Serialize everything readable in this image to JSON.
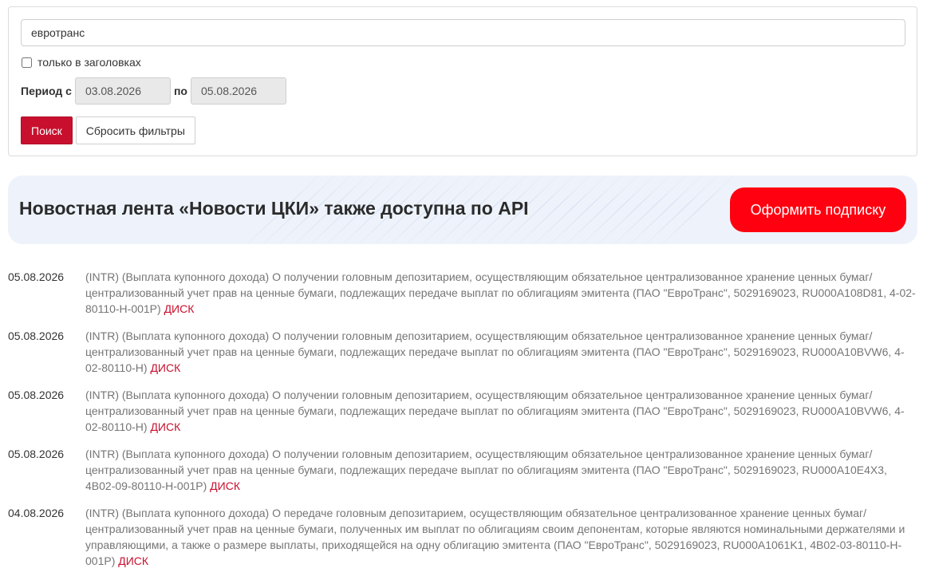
{
  "search": {
    "query": "евротранс",
    "only_headlines_label": "только в заголовках",
    "only_headlines_checked": false
  },
  "period": {
    "from_label": "Период с",
    "from_value": "03.08.2026",
    "to_label": "по",
    "to_value": "05.08.2026"
  },
  "buttons": {
    "search_label": "Поиск",
    "reset_label": "Сбросить фильтры"
  },
  "banner": {
    "title": "Новостная лента «Новости ЦКИ» также доступна по API",
    "subscribe_label": "Оформить подписку"
  },
  "news": [
    {
      "date": "05.08.2026",
      "text": "(INTR) (Выплата купонного дохода) О получении головным депозитарием, осуществляющим обязательное централизованное хранение ценных бумаг/ централизованный учет прав на ценные бумаги, подлежащих передаче выплат по облигациям эмитента (ПАО \"ЕвроТранс\", 5029169023, RU000A108D81, 4-02-80110-H-001P)",
      "source": "ДИСК"
    },
    {
      "date": "05.08.2026",
      "text": "(INTR) (Выплата купонного дохода) О получении головным депозитарием, осуществляющим обязательное централизованное хранение ценных бумаг/ централизованный учет прав на ценные бумаги, подлежащих передаче выплат по облигациям эмитента (ПАО \"ЕвроТранс\", 5029169023, RU000A10BVW6, 4-02-80110-H)",
      "source": "ДИСК"
    },
    {
      "date": "05.08.2026",
      "text": "(INTR) (Выплата купонного дохода) О получении головным депозитарием, осуществляющим обязательное централизованное хранение ценных бумаг/ централизованный учет прав на ценные бумаги, подлежащих передаче выплат по облигациям эмитента (ПАО \"ЕвроТранс\", 5029169023, RU000A10BVW6, 4-02-80110-H)",
      "source": "ДИСК"
    },
    {
      "date": "05.08.2026",
      "text": "(INTR) (Выплата купонного дохода) О получении головным депозитарием, осуществляющим обязательное централизованное хранение ценных бумаг/ централизованный учет прав на ценные бумаги, подлежащих передаче выплат по облигациям эмитента (ПАО \"ЕвроТранс\", 5029169023, RU000A10E4X3, 4B02-09-80110-H-001P)",
      "source": "ДИСК"
    },
    {
      "date": "04.08.2026",
      "text": "(INTR) (Выплата купонного дохода) О передаче головным депозитарием, осуществляющим обязательное централизованное хранение ценных бумаг/ централизованный учет прав на ценные бумаги, полученных им выплат по облигациям своим депонентам, которые являются номинальными держателями и управляющими, а также о размере выплаты, приходящейся на одну облигацию эмитента (ПАО \"ЕвроТранс\", 5029169023, RU000A1061K1, 4B02-03-80110-H-001P)",
      "source": "ДИСК"
    }
  ],
  "colors": {
    "accent": "#c8102e",
    "subscribe": "#ff0010",
    "banner_bg": "#eef3fb",
    "muted_text": "#757575"
  }
}
